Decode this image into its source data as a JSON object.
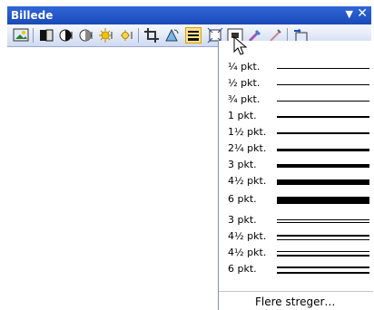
{
  "window": {
    "title": "Billede"
  },
  "toolbar": {
    "icons": [
      "insert-picture-icon",
      "color-icon",
      "more-contrast-icon",
      "less-contrast-icon",
      "more-brightness-icon",
      "less-brightness-icon",
      "crop-icon",
      "rotate-left-icon",
      "line-style-icon",
      "compress-pictures-icon",
      "text-wrapping-icon",
      "format-picture-icon",
      "set-transparent-color-icon",
      "reset-picture-icon"
    ]
  },
  "dropdown": {
    "items": [
      {
        "label": "¼ pkt."
      },
      {
        "label": "½ pkt."
      },
      {
        "label": "¾ pkt."
      },
      {
        "label": "1 pkt."
      },
      {
        "label": "1½ pkt."
      },
      {
        "label": "2¼ pkt."
      },
      {
        "label": "3 pkt."
      },
      {
        "label": "4½ pkt."
      },
      {
        "label": "6 pkt."
      },
      {
        "label": "3 pkt."
      },
      {
        "label": "4½ pkt."
      },
      {
        "label": "4½ pkt."
      },
      {
        "label": "6 pkt."
      }
    ],
    "footer": "Flere streger…"
  }
}
